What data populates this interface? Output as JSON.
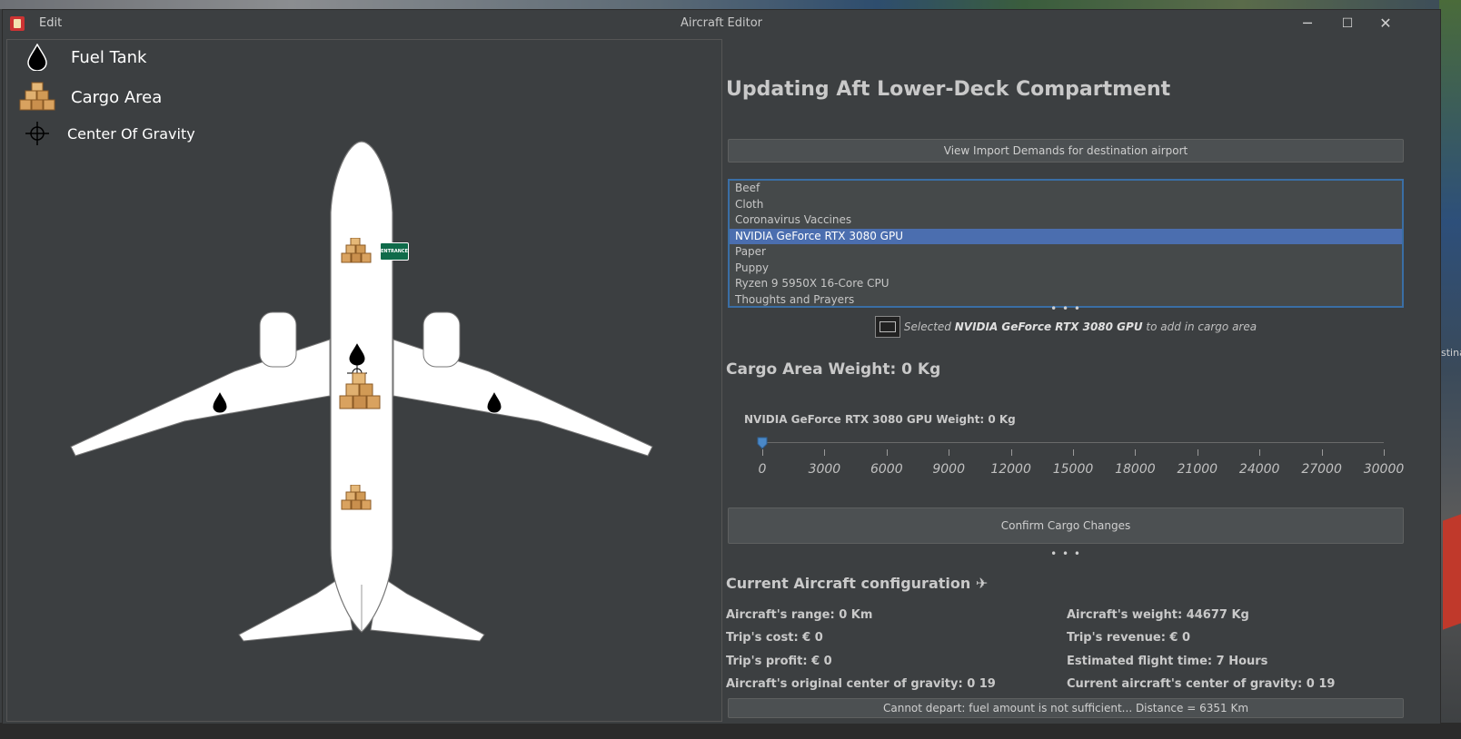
{
  "window": {
    "title": "Aircraft Editor",
    "menu_edit": "Edit",
    "minimize": "─",
    "maximize": "☐",
    "close": "✕"
  },
  "legend": {
    "fuel_tank": "Fuel Tank",
    "cargo_area": "Cargo Area",
    "center_of_gravity": "Center Of Gravity"
  },
  "aircraft": {
    "entrance_label": "ENTRANCE"
  },
  "editor": {
    "heading": "Updating Aft Lower-Deck Compartment",
    "import_button": "View Import Demands for destination airport",
    "cargo_items": [
      "Beef",
      "Cloth",
      "Coronavirus Vaccines",
      "NVIDIA GeForce RTX 3080 GPU",
      "Paper",
      "Puppy",
      "Ryzen 9 5950X 16-Core CPU",
      "Thoughts and Prayers"
    ],
    "selected_index": 3,
    "divider_dots": "• • •",
    "selection_prefix": "Selected",
    "selection_item": "NVIDIA GeForce RTX 3080 GPU",
    "selection_suffix": "to add in cargo area",
    "cargo_area_weight": "Cargo Area Weight: 0 Kg",
    "slider_label": "NVIDIA GeForce RTX 3080 GPU Weight: 0 Kg",
    "slider_value": 0,
    "slider_min": 0,
    "slider_max": 30000,
    "slider_ticks": [
      "0",
      "3000",
      "6000",
      "9000",
      "12000",
      "15000",
      "18000",
      "21000",
      "24000",
      "27000",
      "30000"
    ],
    "confirm_button": "Confirm Cargo Changes"
  },
  "configuration": {
    "title": "Current Aircraft configuration ✈",
    "range": "Aircraft's range: 0 Km",
    "weight": "Aircraft's weight: 44677 Kg",
    "trip_cost": "Trip's cost: € 0",
    "trip_revenue": "Trip's revenue: € 0",
    "trip_profit": "Trip's profit: € 0",
    "flight_time": "Estimated flight time: 7 Hours",
    "original_cog": "Aircraft's original center of gravity: 0 19",
    "current_cog": "Current aircraft's center of gravity: 0 19",
    "status": "Cannot depart: fuel amount is not sufficient... Distance = 6351 Km"
  },
  "background": {
    "side_label": "stina"
  },
  "colors": {
    "window_bg": "#3c3f41",
    "selection": "#4b6eaf",
    "list_border": "#3a6ea5",
    "slider_thumb": "#4a88c7",
    "entrance_sign": "#0f6b4a"
  }
}
